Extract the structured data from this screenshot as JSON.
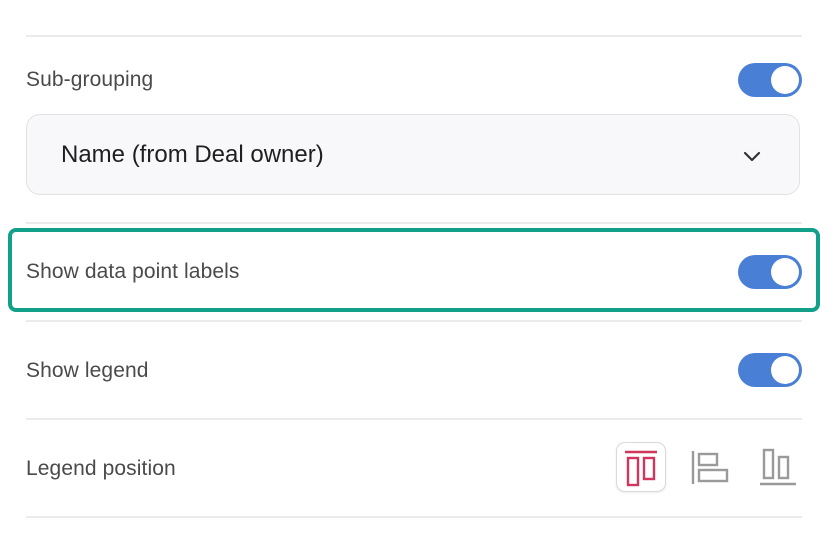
{
  "sub_grouping": {
    "label": "Sub-grouping",
    "enabled": true,
    "select": {
      "value": "Name (from Deal owner)",
      "icon": "chevron-down-icon"
    }
  },
  "show_data_point_labels": {
    "label": "Show data point labels",
    "enabled": true
  },
  "show_legend": {
    "label": "Show legend",
    "enabled": true
  },
  "legend_position": {
    "label": "Legend position",
    "options": [
      {
        "icon": "legend-top-icon",
        "selected": true
      },
      {
        "icon": "legend-left-icon",
        "selected": false
      },
      {
        "icon": "legend-bottom-icon",
        "selected": false
      }
    ]
  },
  "colors": {
    "toggle_on": "#4a7fd6",
    "highlight": "#12a08a",
    "active_icon": "#d1365f",
    "inactive_icon": "#9a9a9a"
  }
}
